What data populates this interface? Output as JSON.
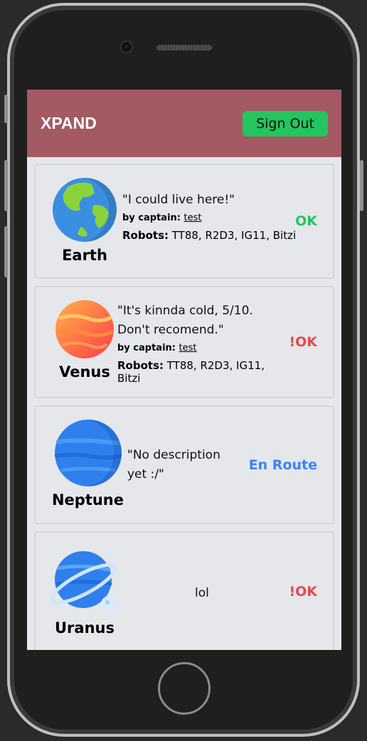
{
  "app": {
    "title": "XPAND",
    "sign_out_label": "Sign Out"
  },
  "planets": [
    {
      "name": "Earth",
      "icon": "earth-icon",
      "quote": "\"I could live here!\"",
      "by_label": "by captain:",
      "captain": "test",
      "robots_label": "Robots:",
      "robots": "TT88, R2D3, IG11, Bitzi",
      "status": "OK"
    },
    {
      "name": "Venus",
      "icon": "venus-icon",
      "quote": "\"It's kinnda cold, 5/10. Don't recomend.\"",
      "by_label": "by captain:",
      "captain": "test",
      "robots_label": "Robots:",
      "robots": "TT88, R2D3, IG11, Bitzi",
      "status": "!OK"
    },
    {
      "name": "Neptune",
      "icon": "neptune-icon",
      "quote": "\"No description yet :/\"",
      "status": "En Route"
    },
    {
      "name": "Uranus",
      "icon": "uranus-icon",
      "quote": "lol",
      "status": "!OK"
    }
  ],
  "colors": {
    "appbar": "#a35a62",
    "ok": "#22c55e",
    "not_ok": "#e5484d",
    "en_route": "#3b82f6"
  }
}
